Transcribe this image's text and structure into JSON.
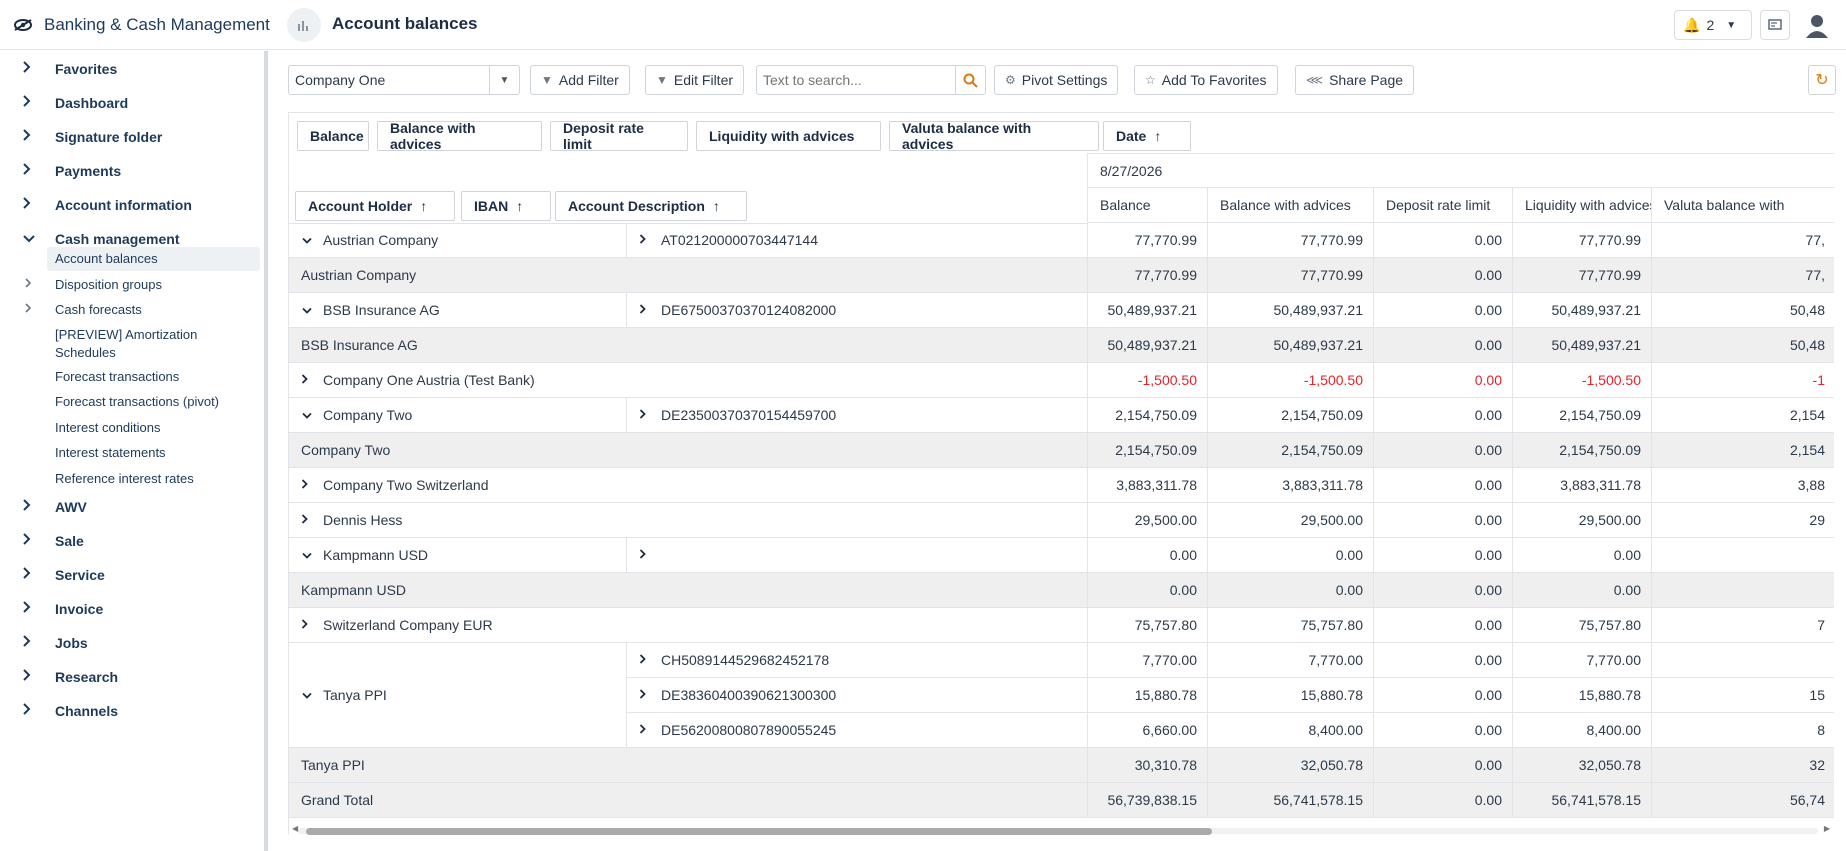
{
  "header": {
    "app_title": "Banking & Cash Management",
    "page_title": "Account balances",
    "notification_count": "2"
  },
  "sidebar": {
    "items": [
      {
        "label": "Favorites",
        "expanded": false
      },
      {
        "label": "Dashboard",
        "expanded": false
      },
      {
        "label": "Signature folder",
        "expanded": false
      },
      {
        "label": "Payments",
        "expanded": false
      },
      {
        "label": "Account information",
        "expanded": false
      },
      {
        "label": "Cash management",
        "expanded": true
      },
      {
        "label": "AWV",
        "expanded": false
      },
      {
        "label": "Sale",
        "expanded": false
      },
      {
        "label": "Service",
        "expanded": false
      },
      {
        "label": "Invoice",
        "expanded": false
      },
      {
        "label": "Jobs",
        "expanded": false
      },
      {
        "label": "Research",
        "expanded": false
      },
      {
        "label": "Channels",
        "expanded": false
      }
    ],
    "cash_management_children": [
      {
        "label": "Account balances",
        "active": true,
        "has_children": false
      },
      {
        "label": "Disposition groups",
        "active": false,
        "has_children": true
      },
      {
        "label": "Cash forecasts",
        "active": false,
        "has_children": true
      },
      {
        "label": "[PREVIEW] Amortization Schedules",
        "active": false,
        "has_children": false
      },
      {
        "label": "Forecast transactions",
        "active": false,
        "has_children": false
      },
      {
        "label": "Forecast transactions (pivot)",
        "active": false,
        "has_children": false
      },
      {
        "label": "Interest conditions",
        "active": false,
        "has_children": false
      },
      {
        "label": "Interest statements",
        "active": false,
        "has_children": false
      },
      {
        "label": "Reference interest rates",
        "active": false,
        "has_children": false
      }
    ]
  },
  "toolbar": {
    "company_select": "Company One",
    "add_filter": "Add Filter",
    "edit_filter": "Edit Filter",
    "search_placeholder": "Text to search...",
    "pivot_settings": "Pivot Settings",
    "add_to_favorites": "Add To Favorites",
    "share_page": "Share Page"
  },
  "pivot": {
    "data_fields": [
      "Balance",
      "Balance with advices",
      "Deposit rate limit",
      "Liquidity with advices",
      "Valuta balance with advices"
    ],
    "column_field": "Date",
    "row_fields": [
      "Account Holder",
      "IBAN",
      "Account Description"
    ],
    "date": "8/27/2026",
    "columns": [
      "Balance",
      "Balance with advices",
      "Deposit rate limit",
      "Liquidity with advices",
      "Valuta balance with"
    ],
    "rows": [
      {
        "type": "detail",
        "holder": "Austrian Company",
        "iban": "AT021200000703447144",
        "values": [
          "77,770.99",
          "77,770.99",
          "0.00",
          "77,770.99",
          "77,"
        ]
      },
      {
        "type": "subtotal",
        "label": "Austrian Company",
        "values": [
          "77,770.99",
          "77,770.99",
          "0.00",
          "77,770.99",
          "77,"
        ]
      },
      {
        "type": "detail",
        "holder": "BSB Insurance AG",
        "iban": "DE67500370370124082000",
        "values": [
          "50,489,937.21",
          "50,489,937.21",
          "0.00",
          "50,489,937.21",
          "50,48"
        ]
      },
      {
        "type": "subtotal",
        "label": "BSB Insurance AG",
        "values": [
          "50,489,937.21",
          "50,489,937.21",
          "0.00",
          "50,489,937.21",
          "50,48"
        ]
      },
      {
        "type": "collapsed",
        "holder": "Company One Austria (Test Bank)",
        "negative": true,
        "values": [
          "-1,500.50",
          "-1,500.50",
          "0.00",
          "-1,500.50",
          "-1"
        ]
      },
      {
        "type": "detail",
        "holder": "Company Two",
        "iban": "DE23500370370154459700",
        "values": [
          "2,154,750.09",
          "2,154,750.09",
          "0.00",
          "2,154,750.09",
          "2,154"
        ]
      },
      {
        "type": "subtotal",
        "label": "Company Two",
        "values": [
          "2,154,750.09",
          "2,154,750.09",
          "0.00",
          "2,154,750.09",
          "2,154"
        ]
      },
      {
        "type": "collapsed",
        "holder": "Company Two Switzerland",
        "values": [
          "3,883,311.78",
          "3,883,311.78",
          "0.00",
          "3,883,311.78",
          "3,88"
        ]
      },
      {
        "type": "collapsed",
        "holder": "Dennis Hess",
        "values": [
          "29,500.00",
          "29,500.00",
          "0.00",
          "29,500.00",
          "29"
        ]
      },
      {
        "type": "detail",
        "holder": "Kampmann USD",
        "iban": "",
        "values": [
          "0.00",
          "0.00",
          "0.00",
          "0.00",
          ""
        ]
      },
      {
        "type": "subtotal",
        "label": "Kampmann USD",
        "values": [
          "0.00",
          "0.00",
          "0.00",
          "0.00",
          ""
        ]
      },
      {
        "type": "collapsed",
        "holder": "Switzerland Company EUR",
        "values": [
          "75,757.80",
          "75,757.80",
          "0.00",
          "75,757.80",
          "7"
        ]
      },
      {
        "type": "group-detail",
        "holder": "Tanya PPI",
        "ibans": [
          {
            "iban": "CH5089144529682452178",
            "values": [
              "7,770.00",
              "7,770.00",
              "0.00",
              "7,770.00",
              ""
            ]
          },
          {
            "iban": "DE38360400390621300300",
            "values": [
              "15,880.78",
              "15,880.78",
              "0.00",
              "15,880.78",
              "15"
            ]
          },
          {
            "iban": "DE56200800807890055245",
            "values": [
              "6,660.00",
              "8,400.00",
              "0.00",
              "8,400.00",
              "8"
            ]
          }
        ]
      },
      {
        "type": "subtotal",
        "label": "Tanya PPI",
        "values": [
          "30,310.78",
          "32,050.78",
          "0.00",
          "32,050.78",
          "32"
        ]
      },
      {
        "type": "grandtotal",
        "label": "Grand Total",
        "values": [
          "56,739,838.15",
          "56,741,578.15",
          "0.00",
          "56,741,578.15",
          "56,74"
        ]
      }
    ]
  }
}
